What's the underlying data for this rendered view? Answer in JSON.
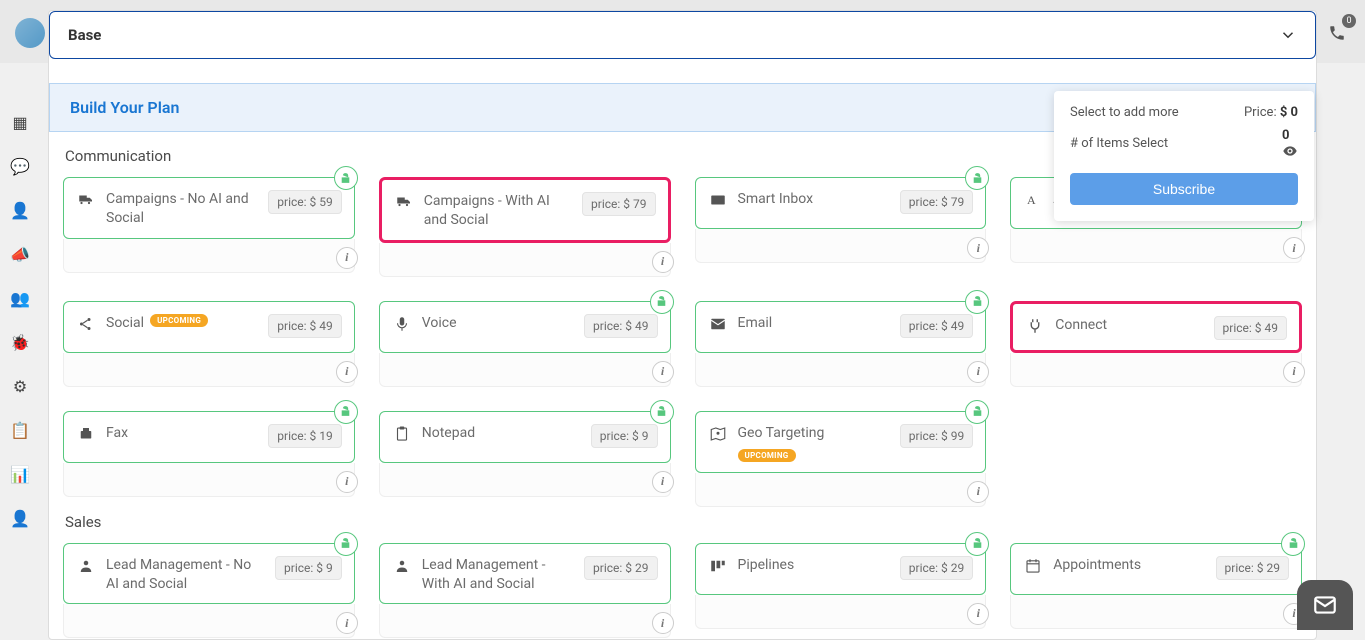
{
  "topbar": {
    "phone_badge": "0"
  },
  "base_select": {
    "label": "Base"
  },
  "section_header": "Build Your Plan",
  "summary": {
    "add_more_label": "Select to add more",
    "price_label": "Price:",
    "price_value": "$ 0",
    "items_label": "# of Items Select",
    "items_value": "0",
    "subscribe_label": "Subscribe"
  },
  "categories": [
    {
      "title": "Communication",
      "items": [
        {
          "title": "Campaigns - No AI and Social",
          "price": "price: $ 59",
          "lock": true,
          "pink": false,
          "upcoming": false,
          "icon": "truck"
        },
        {
          "title": "Campaigns - With AI and Social",
          "price": "price: $ 79",
          "lock": false,
          "pink": true,
          "upcoming": false,
          "icon": "truck"
        },
        {
          "title": "Smart Inbox",
          "price": "price: $ 79",
          "lock": true,
          "pink": false,
          "upcoming": false,
          "icon": "inbox"
        },
        {
          "title": "A",
          "price": "",
          "lock": false,
          "pink": false,
          "upcoming": false,
          "icon": "letter"
        },
        {
          "title": "Social",
          "price": "price: $ 49",
          "lock": false,
          "pink": false,
          "upcoming": true,
          "icon": "share"
        },
        {
          "title": "Voice",
          "price": "price: $ 49",
          "lock": true,
          "pink": false,
          "upcoming": false,
          "icon": "mic"
        },
        {
          "title": "Email",
          "price": "price: $ 49",
          "lock": true,
          "pink": false,
          "upcoming": false,
          "icon": "envelope"
        },
        {
          "title": "Connect",
          "price": "price: $ 49",
          "lock": false,
          "pink": true,
          "upcoming": false,
          "icon": "plug"
        },
        {
          "title": "Fax",
          "price": "price: $ 19",
          "lock": true,
          "pink": false,
          "upcoming": false,
          "icon": "fax"
        },
        {
          "title": "Notepad",
          "price": "price: $ 9",
          "lock": true,
          "pink": false,
          "upcoming": false,
          "icon": "clipboard"
        },
        {
          "title": "Geo Targeting",
          "price": "price: $ 99",
          "lock": true,
          "pink": false,
          "upcoming": true,
          "icon": "map"
        }
      ]
    },
    {
      "title": "Sales",
      "items": [
        {
          "title": "Lead Management - No AI and Social",
          "price": "price: $ 9",
          "lock": true,
          "pink": false,
          "upcoming": false,
          "icon": "person"
        },
        {
          "title": "Lead Management - With AI and Social",
          "price": "price: $ 29",
          "lock": false,
          "pink": false,
          "upcoming": false,
          "icon": "person"
        },
        {
          "title": "Pipelines",
          "price": "price: $ 29",
          "lock": true,
          "pink": false,
          "upcoming": false,
          "icon": "pipeline"
        },
        {
          "title": "Appointments",
          "price": "price: $ 29",
          "lock": true,
          "pink": false,
          "upcoming": false,
          "icon": "calendar"
        }
      ]
    }
  ],
  "upcoming_label": "UPCOMING"
}
